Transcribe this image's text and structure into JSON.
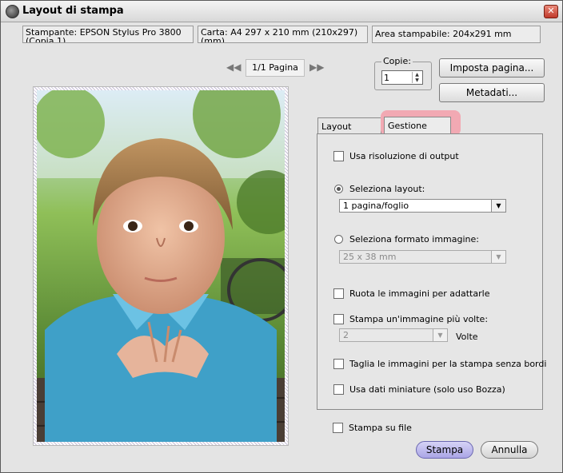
{
  "window": {
    "title": "Layout di stampa",
    "close_glyph": "✕"
  },
  "info": {
    "printer": "Stampante:  EPSON Stylus Pro 3800 (Copia 1)",
    "paper": "Carta:  A4 297 x 210 mm (210x297) (mm)",
    "printable": "Area stampabile:  204x291 mm"
  },
  "pager": {
    "label": "1/1 Pagina",
    "prev_glyph": "◀◀",
    "next_glyph": "▶▶"
  },
  "copies": {
    "label": "Copie:",
    "value": "1"
  },
  "buttons": {
    "page_setup": "Imposta pagina...",
    "metadata": "Metadati...",
    "print": "Stampa",
    "cancel": "Annulla"
  },
  "tabs": [
    {
      "label": "Layout pagina"
    },
    {
      "label": "Gestione colore"
    }
  ],
  "options": {
    "output_resolution": "Usa risoluzione di output",
    "select_layout": "Seleziona layout:",
    "layout_value": "1 pagina/foglio",
    "select_image_format": "Seleziona formato immagine:",
    "image_format_value": "25 x 38 mm",
    "rotate": "Ruota le immagini per adattarle",
    "print_multiple": "Stampa un'immagine più volte:",
    "times_value": "2",
    "times_label": "Volte",
    "crop": "Taglia le immagini per la stampa senza bordi",
    "thumbnail": "Usa dati miniature (solo uso Bozza)",
    "print_to_file": "Stampa su file"
  },
  "icons": {
    "dropdown": "▼",
    "spin_up": "▲",
    "spin_down": "▼"
  },
  "colors": {
    "accent": "#b7b3ea",
    "tab_highlight": "#f2a9b3"
  }
}
